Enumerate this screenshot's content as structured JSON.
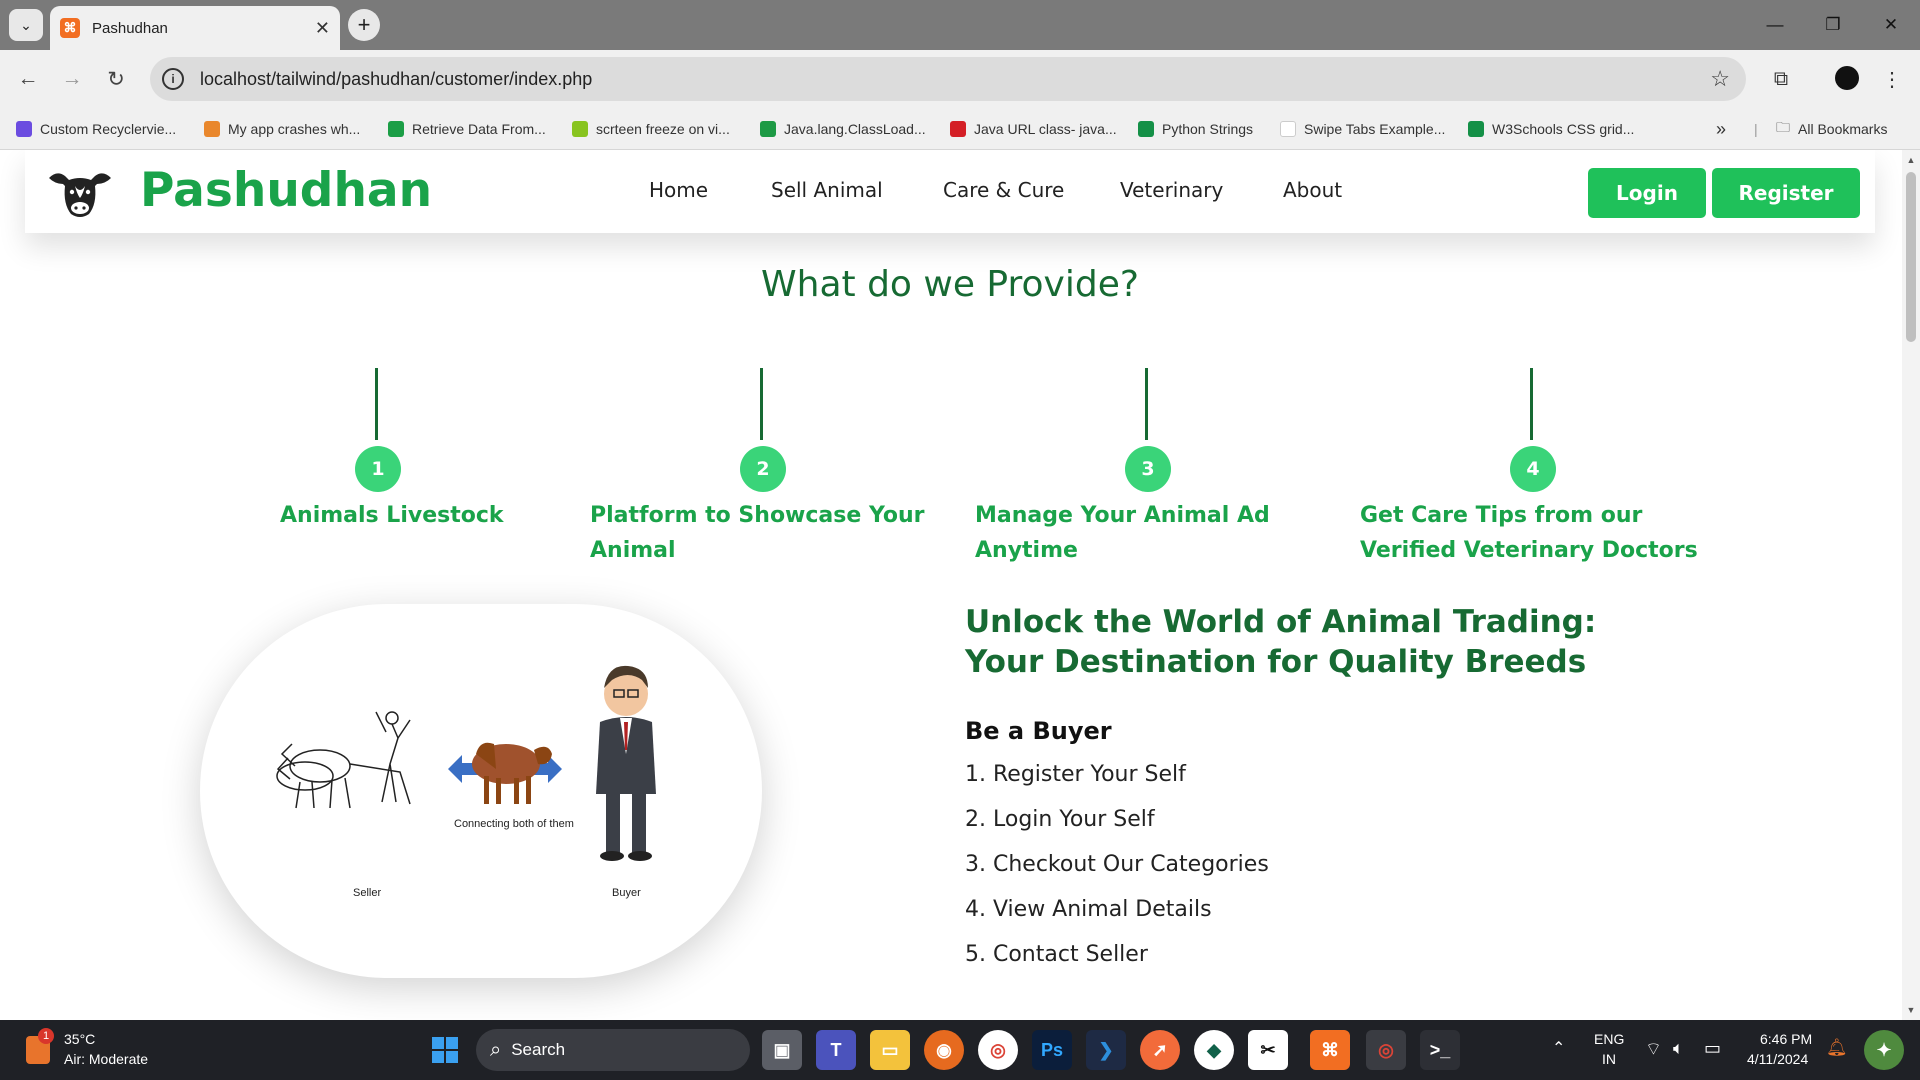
{
  "browser": {
    "tab_title": "Pashudhan",
    "url": "localhost/tailwind/pashudhan/customer/index.php",
    "bookmarks": [
      {
        "label": "Custom Recyclervie...",
        "color": "#6b4ce0"
      },
      {
        "label": "My app crashes wh...",
        "color": "#e9872c"
      },
      {
        "label": "Retrieve Data From...",
        "color": "#1b9e46"
      },
      {
        "label": "scrteen freeze on vi...",
        "color": "#88c41f"
      },
      {
        "label": "Java.lang.ClassLoad...",
        "color": "#1d9a45"
      },
      {
        "label": "Java URL class- java...",
        "color": "#d41f26"
      },
      {
        "label": "Python Strings",
        "color": "#149047"
      },
      {
        "label": "Swipe Tabs Example...",
        "color": "#ffffff"
      },
      {
        "label": "W3Schools CSS grid...",
        "color": "#149047"
      }
    ],
    "all_bookmarks": "All Bookmarks"
  },
  "site": {
    "brand": "Pashudhan",
    "nav": [
      "Home",
      "Sell Animal",
      "Care & Cure",
      "Veterinary",
      "About"
    ],
    "login": "Login",
    "register": "Register",
    "section_title": "What do we Provide?",
    "steps": [
      {
        "num": "1",
        "label": "Animals Livestock"
      },
      {
        "num": "2",
        "label": "Platform to Showcase Your Animal"
      },
      {
        "num": "3",
        "label": "Manage Your Animal Ad Anytime"
      },
      {
        "num": "4",
        "label": "Get Care Tips from our Verified Veterinary Doctors"
      }
    ],
    "illustration": {
      "connect_caption": "Connecting both of them",
      "seller_caption": "Seller",
      "buyer_caption": "Buyer"
    },
    "headline": "Unlock the World of Animal Trading: Your Destination for Quality Breeds",
    "buyer_title": "Be a Buyer",
    "buyer_steps": [
      "1. Register Your Self",
      "2. Login Your Self",
      "3. Checkout Our Categories",
      "4. View Animal Details",
      "5. Contact Seller"
    ]
  },
  "taskbar": {
    "weather_temp": "35°C",
    "weather_desc": "Air: Moderate",
    "weather_badge": "1",
    "search_label": "Search",
    "lang_line1": "ENG",
    "lang_line2": "IN",
    "time": "6:46 PM",
    "date": "4/11/2024"
  },
  "colors": {
    "brand_green": "#1aa34a",
    "dark_green": "#176a33",
    "button_green": "#1fc15a",
    "circle_green": "#3ad479"
  }
}
